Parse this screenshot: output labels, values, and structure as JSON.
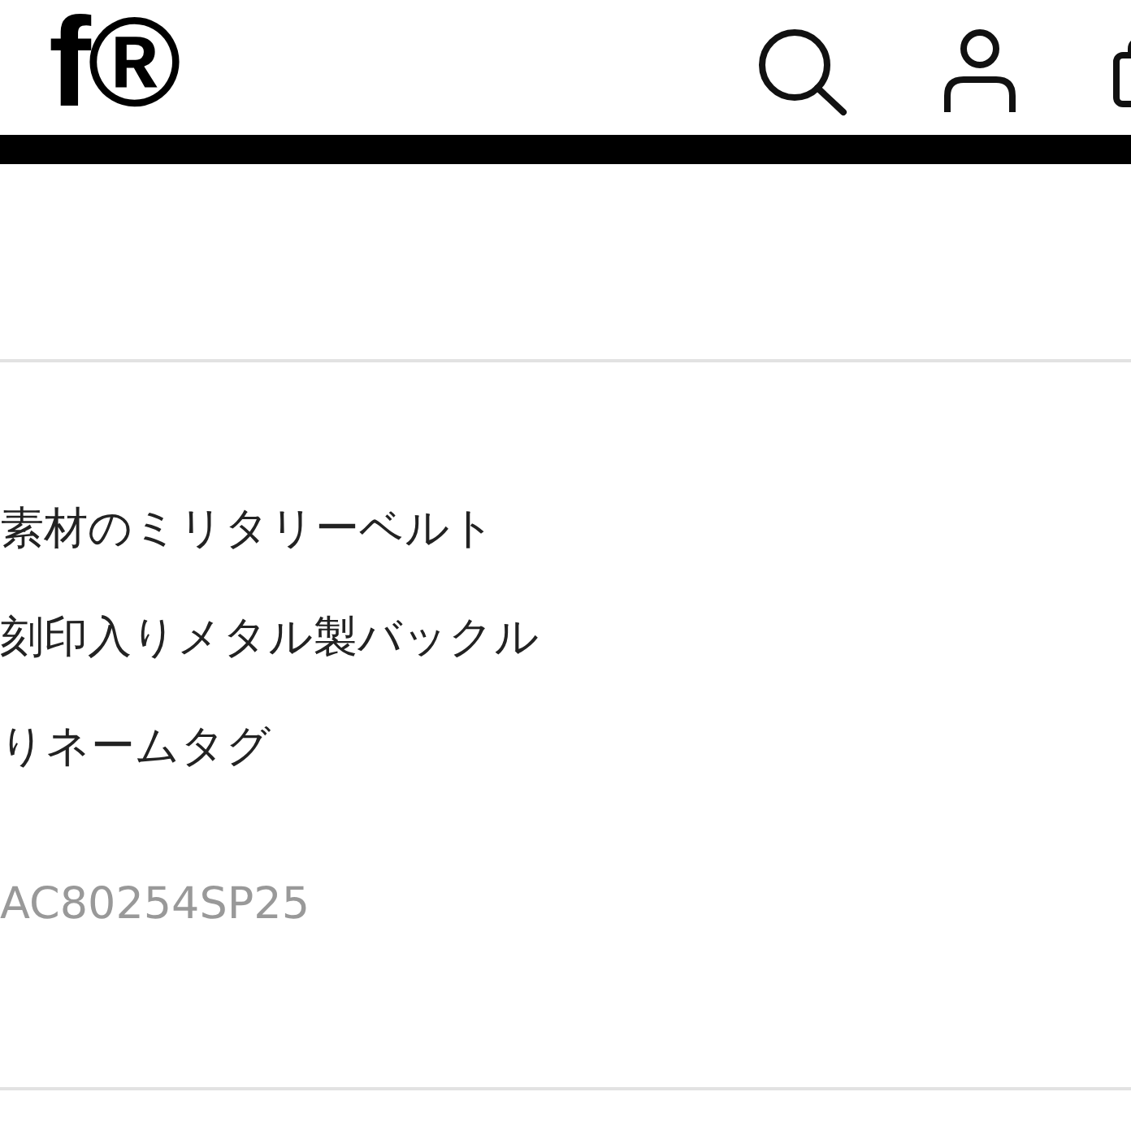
{
  "header": {
    "logo": "f®"
  },
  "features": [
    "素材のミリタリーベルト",
    "刻印入りメタル製バックル",
    "りネームタグ"
  ],
  "product_code": "AC80254SP25"
}
